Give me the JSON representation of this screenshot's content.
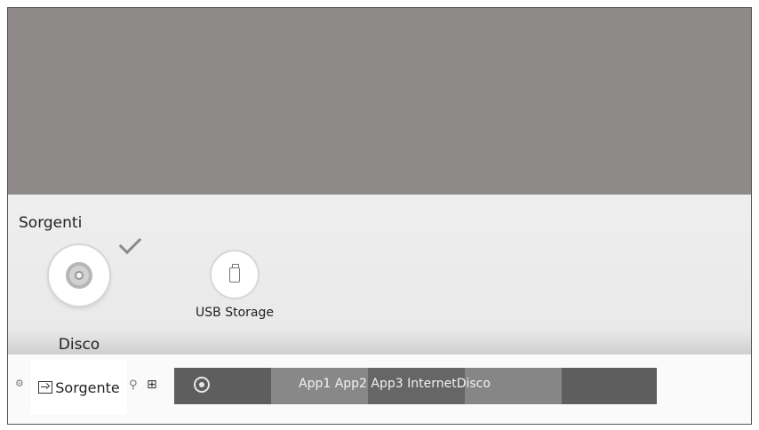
{
  "sources_panel": {
    "title": "Sorgenti",
    "items": [
      {
        "label": "Disco",
        "icon": "disc-icon",
        "selected": true
      },
      {
        "label": "USB Storage",
        "icon": "usb-icon",
        "selected": false
      }
    ]
  },
  "bottom_bar": {
    "source_label": "Sorgente",
    "icons": [
      "gear-icon",
      "input-icon",
      "search-icon",
      "apps-icon"
    ],
    "apps_text": "App1 App2 App3 InternetDisco",
    "app_icons": [
      "disc-icon",
      "globe-icon"
    ]
  }
}
